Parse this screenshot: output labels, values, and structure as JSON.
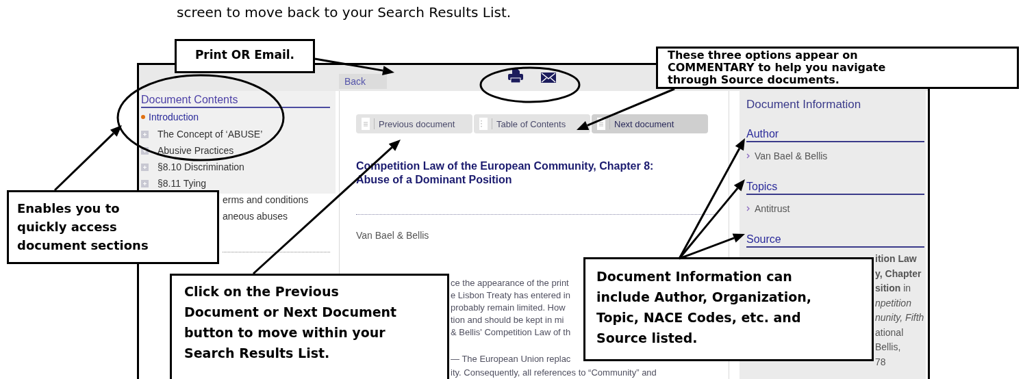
{
  "intro_line": "screen to move back to your Search Results List.",
  "toolbar": {
    "back": "Back"
  },
  "contents": {
    "title": "Document Contents",
    "items": [
      {
        "label": "Introduction",
        "kind": "current"
      },
      {
        "label": "The Concept of ‘ABUSE’",
        "kind": "expandable"
      },
      {
        "label": "Abusive Practices",
        "kind": "expandable"
      },
      {
        "label": "§8.10 Discrimination",
        "kind": "expandable"
      },
      {
        "label": "§8.11 Tying",
        "kind": "expandable"
      },
      {
        "label": "erms and conditions",
        "kind": "plain"
      },
      {
        "label": "aneous abuses",
        "kind": "plain"
      }
    ]
  },
  "nav_buttons": [
    {
      "label": "Previous document",
      "kind": "page",
      "selected": false
    },
    {
      "label": "Table of Contents",
      "kind": "toc",
      "selected": false
    },
    {
      "label": "Next document",
      "kind": "page",
      "selected": true
    }
  ],
  "document": {
    "title": "Competition Law of the European Community, Chapter 8: Abuse of a Dominant Position",
    "author": "Van Bael & Bellis",
    "paragraphs": [
      [
        "ce the appearance of the print",
        "e Lisbon Treaty has entered in",
        "probably remain limited. How",
        "tion and should be kept in mi",
        "& Bellis' Competition Law of th"
      ],
      [
        "— The European Union replac",
        "ity. Consequently, all references to “Community” and"
      ]
    ]
  },
  "info": {
    "title": "Document Information",
    "sections": [
      {
        "heading": "Author",
        "items": [
          "Van Bael & Bellis"
        ]
      },
      {
        "heading": "Topics",
        "items": [
          "Antitrust"
        ]
      },
      {
        "heading": "Source"
      }
    ],
    "source_lines": [
      {
        "text": "ition Law",
        "kind": "title"
      },
      {
        "text": "y, Chapter",
        "kind": "title"
      },
      {
        "text": "**sition** in",
        "kind": "text"
      },
      {
        "text": "npetition",
        "kind": "book"
      },
      {
        "text": "nunity, Fifth",
        "kind": "book"
      },
      {
        "text": "ational",
        "kind": "text"
      },
      {
        "text": "Bellis,",
        "kind": "text"
      },
      {
        "text": "78",
        "kind": "text"
      }
    ]
  },
  "callouts": [
    {
      "text": "Print OR Email.",
      "kind": "print"
    },
    {
      "text": "These three options appear on\nCOMMENTARY to help you navigate\nthrough Source documents.",
      "kind": "options"
    },
    {
      "text": "Enables you to\nquickly access\ndocument sections",
      "kind": "contents"
    },
    {
      "text": "Click on the Previous\nDocument or Next Document\nbutton to move within your\nSearch Results List.",
      "kind": "navigate"
    },
    {
      "text": "Document Information can\ninclude Author, Organization,\nTopic, NACE Codes, etc. and\nSource listed.",
      "kind": "info"
    }
  ]
}
